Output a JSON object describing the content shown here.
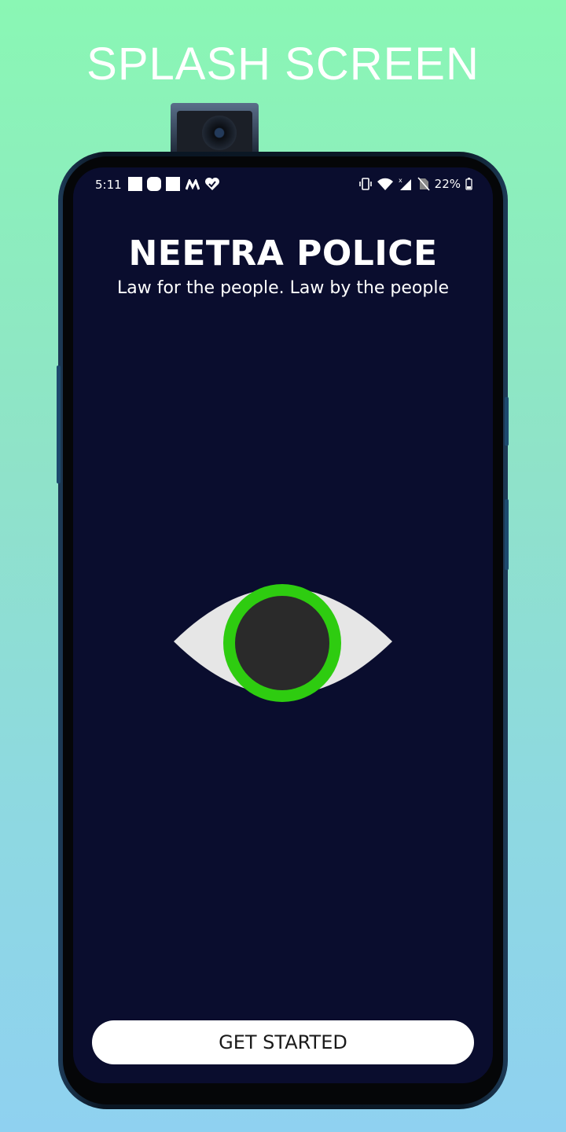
{
  "promo": {
    "title": "SPLASH SCREEN"
  },
  "status_bar": {
    "time": "5:11",
    "battery": "22%",
    "left_icons": [
      "notification-square-icon",
      "notification-rounded-icon",
      "notification-square-icon",
      "m-app-icon",
      "heart-check-icon"
    ],
    "right_icons": [
      "vibrate-icon",
      "wifi-icon",
      "signal-icon",
      "no-sim-icon",
      "battery-icon"
    ]
  },
  "app": {
    "title": "NEETRA POLICE",
    "tagline": "Law for the people. Law by the people",
    "logo": "eye-icon",
    "cta_label": "GET STARTED"
  },
  "colors": {
    "screen_bg": "#0a0d2e",
    "iris": "#2ecc10",
    "pupil": "#2a2a2a",
    "sclera": "#e6e6e6",
    "button_bg": "#ffffff"
  }
}
